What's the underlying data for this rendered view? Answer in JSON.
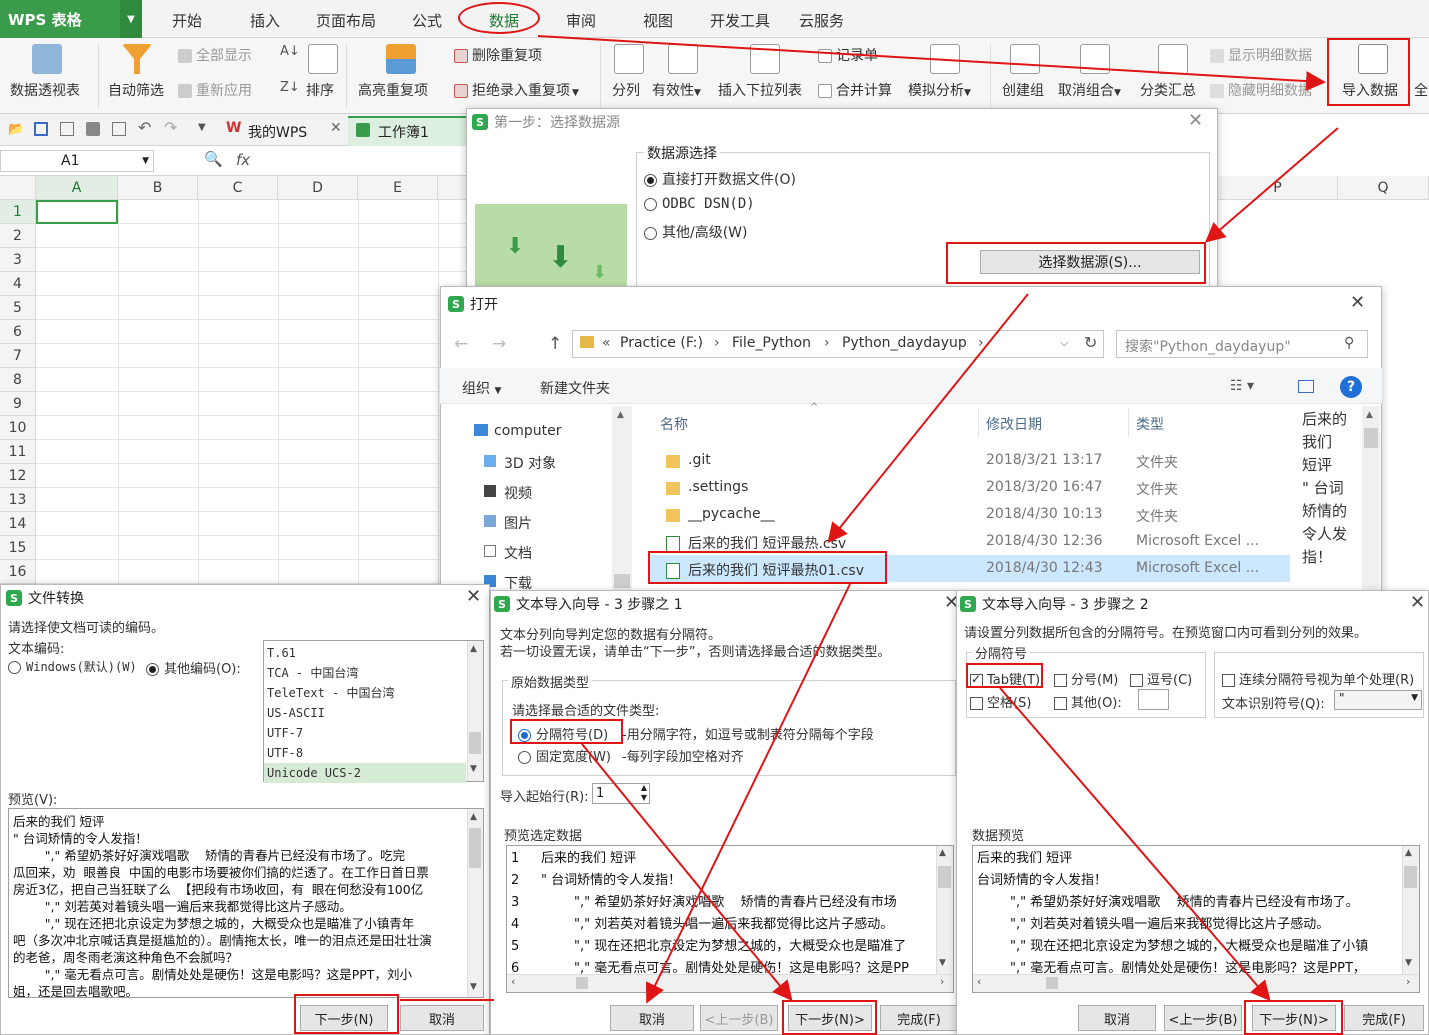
{
  "app": {
    "name": "WPS 表格",
    "tabs": [
      "开始",
      "插入",
      "页面布局",
      "公式",
      "数据",
      "审阅",
      "视图",
      "开发工具",
      "云服务"
    ]
  },
  "ribbon": {
    "pivot": "数据透视表",
    "autofilter": "自动筛选",
    "show_all": "全部显示",
    "reapply": "重新应用",
    "sort": "排序",
    "highlight_dup": "高亮重复项",
    "delete_dup": "删除重复项",
    "reject_dup": "拒绝录入重复项",
    "split": "分列",
    "validity": "有效性",
    "insert_dropdown": "插入下拉列表",
    "record_form": "记录单",
    "merge_calc": "合并计算",
    "simulate": "模拟分析",
    "create_group": "创建组",
    "ungroup": "取消组合",
    "subtotal": "分类汇总",
    "show_detail": "显示明细数据",
    "hide_detail": "隐藏明细数据",
    "import_data": "导入数据",
    "more": "全"
  },
  "quick_access": {
    "tab_mywps": "我的WPS",
    "tab_book": "工作簿1"
  },
  "formula_bar": {
    "name_box": "A1",
    "fx": "fx"
  },
  "sheet": {
    "columns": [
      "A",
      "B",
      "C",
      "D",
      "E"
    ],
    "right_columns": [
      "P",
      "Q"
    ],
    "rows": [
      "1",
      "2",
      "3",
      "4",
      "5",
      "6",
      "7",
      "8",
      "9",
      "10",
      "11",
      "12",
      "13",
      "14",
      "15",
      "16"
    ]
  },
  "step1": {
    "title": "第一步：选择数据源",
    "group": "数据源选择",
    "opt1": "直接打开数据文件(O)",
    "opt2": "ODBC DSN(D)",
    "opt3": "其他/高级(W)",
    "button": "选择数据源(S)..."
  },
  "open_dialog": {
    "title": "打开",
    "path": [
      "«",
      "Practice (F:)",
      "File_Python",
      "Python_daydayup"
    ],
    "search_placeholder": "搜索\"Python_daydayup\"",
    "organize": "组织",
    "new_folder": "新建文件夹",
    "nav": [
      "computer",
      "3D 对象",
      "视频",
      "图片",
      "文档",
      "下载"
    ],
    "headers": {
      "name": "名称",
      "date": "修改日期",
      "type": "类型"
    },
    "files": [
      {
        "name": ".git",
        "date": "2018/3/21 13:17",
        "type": "文件夹"
      },
      {
        "name": ".settings",
        "date": "2018/3/20 16:47",
        "type": "文件夹"
      },
      {
        "name": "__pycache__",
        "date": "2018/4/30 10:13",
        "type": "文件夹"
      },
      {
        "name": "后来的我们 短评最热.csv",
        "date": "2018/4/30 12:36",
        "type": "Microsoft Excel ..."
      },
      {
        "name": "后来的我们 短评最热01.csv",
        "date": "2018/4/30 12:43",
        "type": "Microsoft Excel ..."
      }
    ],
    "preview_text": [
      "后来的",
      "我们",
      "短评",
      "\" 台词",
      "矫情的",
      "令人发",
      "指！"
    ]
  },
  "convert": {
    "title": "文件转换",
    "instruction": "请选择使文档可读的编码。",
    "encoding_label": "文本编码:",
    "opt_windows": "Windows(默认)(W)",
    "opt_other": "其他编码(O):",
    "encodings": [
      "T.61",
      "TCA - 中国台湾",
      "TeleText - 中国台湾",
      "US-ASCII",
      "UTF-7",
      "UTF-8",
      "Unicode UCS-2"
    ],
    "preview_label": "预览(V):",
    "preview_lines": [
      "后来的我们 短评",
      "\" 台词矫情的令人发指！",
      "        \",\" 希望奶茶好好演戏唱歌    矫情的青春片已经没有市场了。吃完",
      "瓜回来，劝  眼善良  中国的电影市场要被你们搞的烂透了。在工作日首日票",
      "房近3亿，把自己当狂联了么  【把段有市场收回，有  眼在何愁没有100亿",
      "        \",\" 刘若英对着镜头唱一遍后来我都觉得比这片子感动。",
      "        \",\" 现在还把北京设定为梦想之城的，大概受众也是瞄准了小镇青年",
      "吧（多次冲北京喊话真是挺尴尬的）。剧情拖太长，唯一的泪点还是田壮壮演",
      "的老爸，周冬雨老演这种角色不会腻吗？",
      "        \",\" 毫无看点可言。剧情处处是硬伤！这是电影吗？这是PPT，刘小",
      "姐，还是回去唱歌吧。"
    ],
    "next": "下一步(N)",
    "cancel": "取消"
  },
  "wizard1": {
    "title": "文本导入向导 - 3 步骤之 1",
    "line1": "文本分列向导判定您的数据有分隔符。",
    "line2": "若一切设置无误，请单击“下一步”，否则请选择最合适的数据类型。",
    "group": "原始数据类型",
    "choose": "请选择最合适的文件类型:",
    "opt_delim": "分隔符号(D)",
    "opt_delim_desc": "-用分隔字符，如逗号或制表符分隔每个字段",
    "opt_fixed": "固定宽度(W)",
    "opt_fixed_desc": "-每列字段加空格对齐",
    "start_row_label": "导入起始行(R):",
    "start_row": "1",
    "preview_label": "预览选定数据",
    "preview": [
      [
        "1",
        "后来的我们 短评"
      ],
      [
        "2",
        "\" 台词矫情的令人发指！"
      ],
      [
        "3",
        "        \",\" 希望奶茶好好演戏唱歌    矫情的青春片已经没有市场"
      ],
      [
        "4",
        "        \",\" 刘若英对着镜头唱一遍后来我都觉得比这片子感动。"
      ],
      [
        "5",
        "        \",\" 现在还把北京设定为梦想之城的，大概受众也是瞄准了"
      ],
      [
        "6",
        "        \",\" 毫无看点可言。剧情处处是硬伤！这是电影吗？这是PP"
      ]
    ],
    "cancel": "取消",
    "prev": "<上一步(B)",
    "next": "下一步(N)>",
    "finish": "完成(F)"
  },
  "wizard2": {
    "title": "文本导入向导 - 3 步骤之 2",
    "instruction": "请设置分列数据所包含的分隔符号。在预览窗口内可看到分列的效果。",
    "group": "分隔符号",
    "tab": "Tab键(T)",
    "semicolon": "分号(M)",
    "comma": "逗号(C)",
    "space": "空格(S)",
    "other": "其他(O):",
    "consecutive": "连续分隔符号视为单个处理(R)",
    "qualifier_label": "文本识别符号(Q):",
    "qualifier": "\"",
    "preview_label": "数据预览",
    "preview": [
      "后来的我们 短评",
      "台词矫情的令人发指！",
      "        \",\" 希望奶茶好好演戏唱歌    矫情的青春片已经没有市场了。",
      "        \",\" 刘若英对着镜头唱一遍后来我都觉得比这片子感动。",
      "        \",\" 现在还把北京设定为梦想之城的，大概受众也是瞄准了小镇",
      "        \",\" 毫无看点可言。剧情处处是硬伤！这是电影吗？这是PPT，"
    ],
    "cancel": "取消",
    "prev": "<上一步(B)",
    "next": "下一步(N)>",
    "finish": "完成(F)"
  },
  "colors": {
    "accent_green": "#3a9b4a",
    "highlight_red": "#e01515",
    "selection": "#cce8ff"
  }
}
